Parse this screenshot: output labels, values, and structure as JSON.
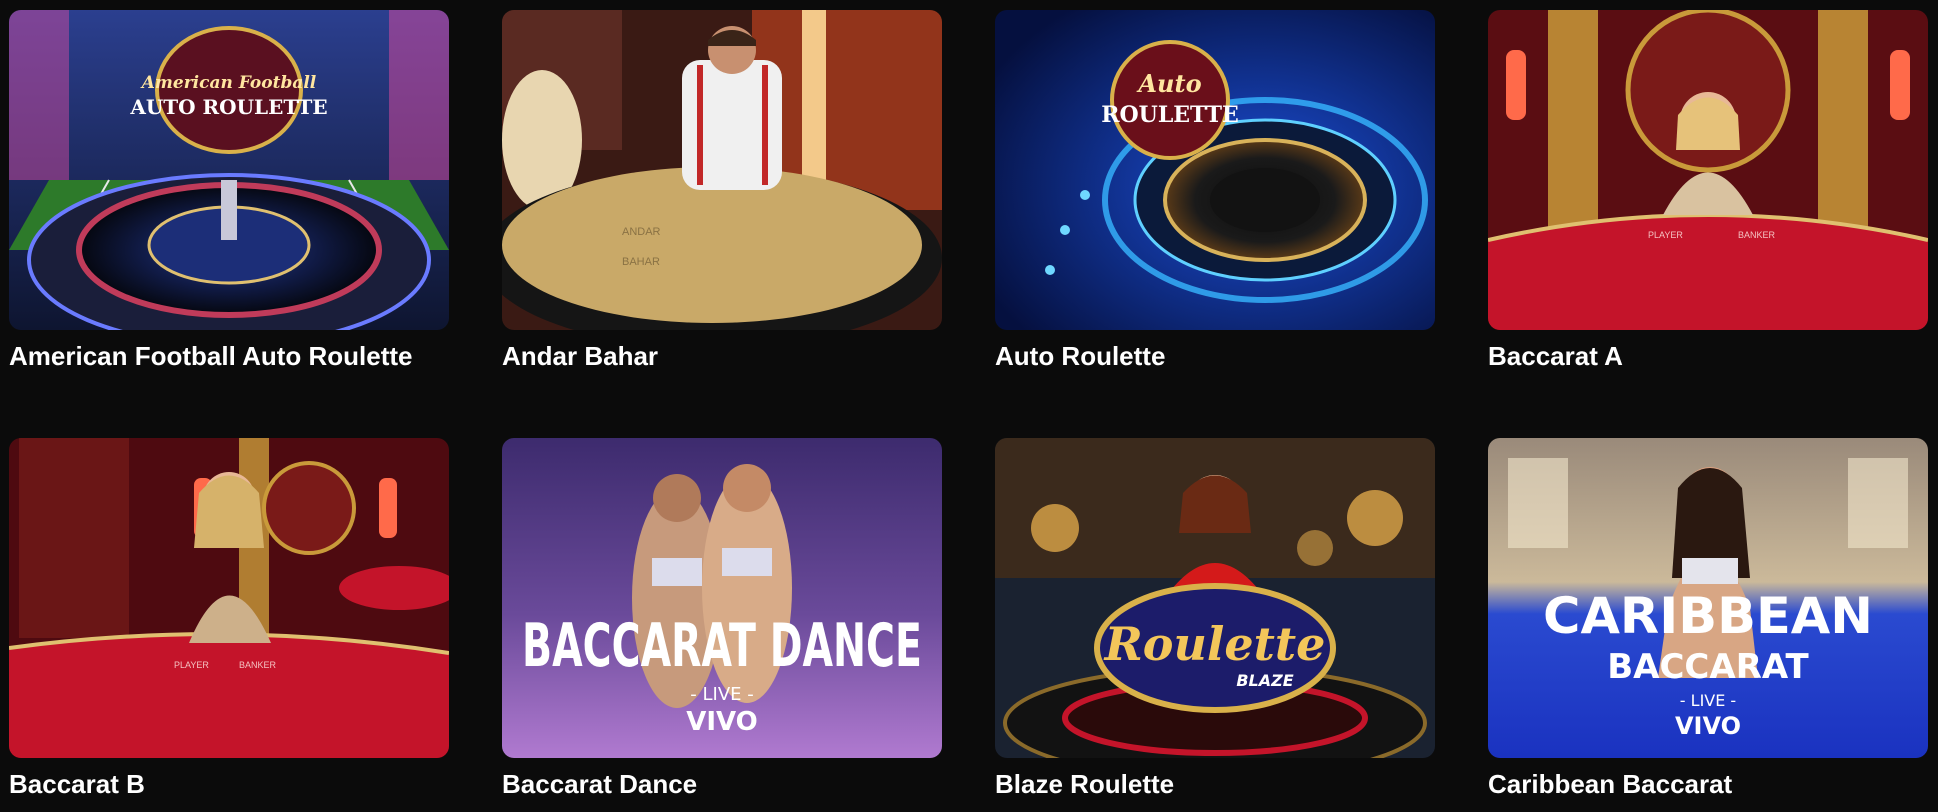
{
  "games": [
    {
      "title": "American Football Auto Roulette",
      "logo_line1": "American Football",
      "logo_line2": "AUTO ROULETTE"
    },
    {
      "title": "Andar Bahar",
      "table_label_1": "ANDAR",
      "table_label_2": "BAHAR"
    },
    {
      "title": "Auto Roulette",
      "logo_line1": "Auto",
      "logo_line2": "ROULETTE"
    },
    {
      "title": "Baccarat A",
      "table_label_1": "PLAYER",
      "table_label_2": "BANKER"
    },
    {
      "title": "Baccarat B",
      "table_label_1": "PLAYER",
      "table_label_2": "BANKER"
    },
    {
      "title": "Baccarat Dance",
      "logo_line1": "BACCARAT DANCE",
      "logo_line2": "- LIVE -",
      "logo_line3": "VIVO"
    },
    {
      "title": "Blaze Roulette",
      "logo_line1": "Roulette",
      "logo_line2": "BLAZE"
    },
    {
      "title": "Caribbean Baccarat",
      "logo_line1": "CARIBBEAN",
      "logo_line2": "BACCARAT",
      "logo_line3": "- LIVE -",
      "logo_line4": "VIVO"
    }
  ],
  "colors": {
    "background": "#0b0b0b",
    "title_text": "#ffffff"
  }
}
